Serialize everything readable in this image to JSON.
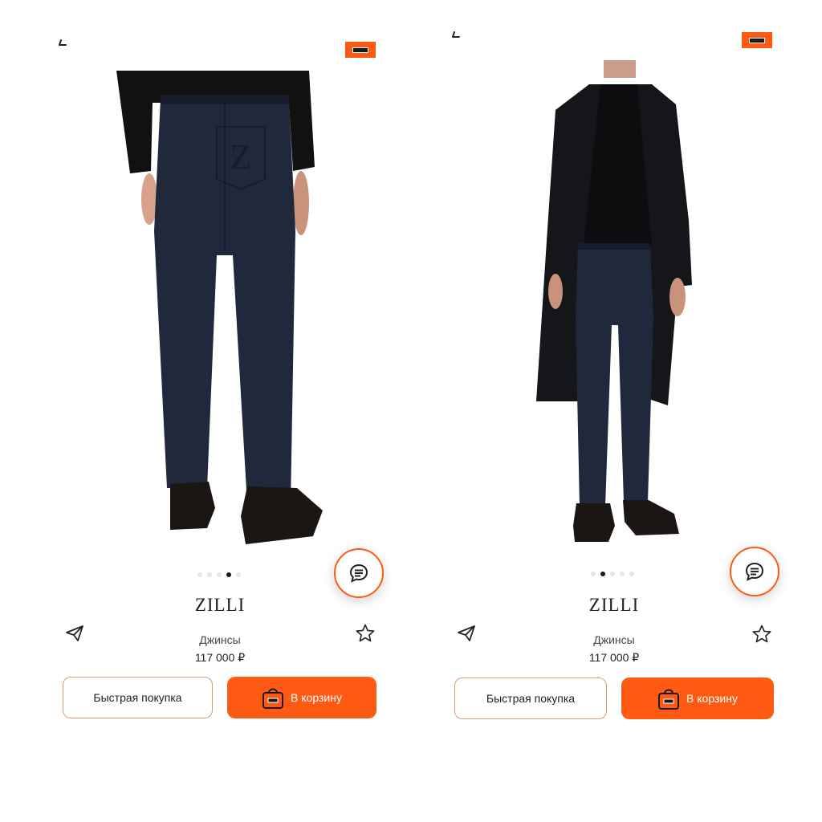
{
  "colors": {
    "accent": "#ff5a14",
    "pants": "#20283c",
    "garment": "#15161a"
  },
  "screens": [
    {
      "icons": {
        "back": "chevron-left-icon",
        "logo": "bag-logo-icon",
        "chat": "chat-icon",
        "share": "paper-plane-icon",
        "favorite": "star-icon"
      },
      "gallery": {
        "image_index": 4,
        "image_count": 5,
        "photo": "jeans back view"
      },
      "product": {
        "brand": "ZILLI",
        "type": "Джинсы",
        "price": "117 000 ₽"
      },
      "actions": {
        "quick_buy": "Быстрая покупка",
        "add_to_cart": "В корзину"
      }
    },
    {
      "icons": {
        "back": "chevron-left-icon",
        "logo": "bag-logo-icon",
        "chat": "chat-icon",
        "share": "paper-plane-icon",
        "favorite": "star-icon"
      },
      "gallery": {
        "image_index": 2,
        "image_count": 5,
        "photo": "model in coat front view"
      },
      "product": {
        "brand": "ZILLI",
        "type": "Джинсы",
        "price": "117 000 ₽"
      },
      "actions": {
        "quick_buy": "Быстрая покупка",
        "add_to_cart": "В корзину"
      }
    }
  ]
}
